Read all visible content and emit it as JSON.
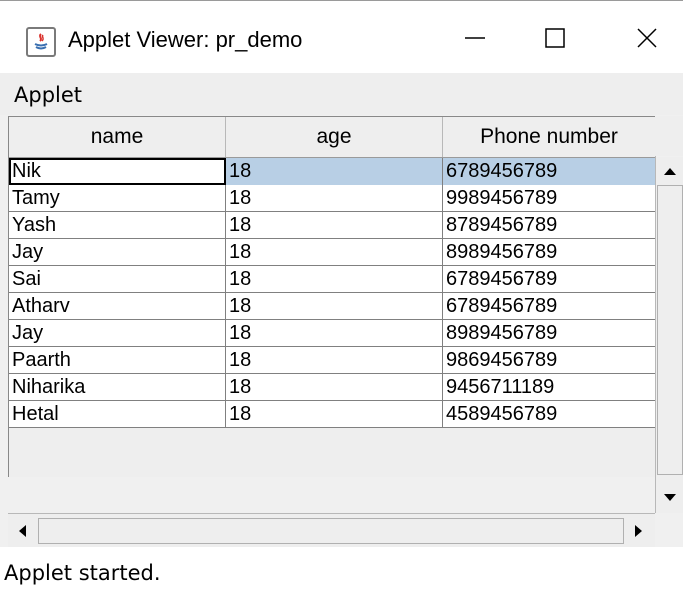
{
  "window": {
    "title": "Applet Viewer: pr_demo",
    "app_icon": "java-applet-icon",
    "controls": {
      "minimize": "minimize-icon",
      "maximize": "maximize-icon",
      "close": "close-icon"
    }
  },
  "menubar": {
    "items": [
      "Applet"
    ]
  },
  "table": {
    "columns": [
      "name",
      "age",
      "Phone number"
    ],
    "rows": [
      {
        "name": "Nik",
        "age": "18",
        "phone": "6789456789"
      },
      {
        "name": "Tamy",
        "age": "18",
        "phone": "9989456789"
      },
      {
        "name": "Yash",
        "age": "18",
        "phone": "8789456789"
      },
      {
        "name": "Jay",
        "age": "18",
        "phone": "8989456789"
      },
      {
        "name": "Sai",
        "age": "18",
        "phone": "6789456789"
      },
      {
        "name": "Atharv",
        "age": "18",
        "phone": "6789456789"
      },
      {
        "name": "Jay",
        "age": "18",
        "phone": "8989456789"
      },
      {
        "name": "Paarth",
        "age": "18",
        "phone": "9869456789"
      },
      {
        "name": "Niharika",
        "age": "18",
        "phone": "9456711189"
      },
      {
        "name": "Hetal",
        "age": "18",
        "phone": "4589456789"
      }
    ],
    "selected_row": 0,
    "selection_color": "#b8cfe5"
  },
  "status": {
    "text": "Applet started."
  }
}
